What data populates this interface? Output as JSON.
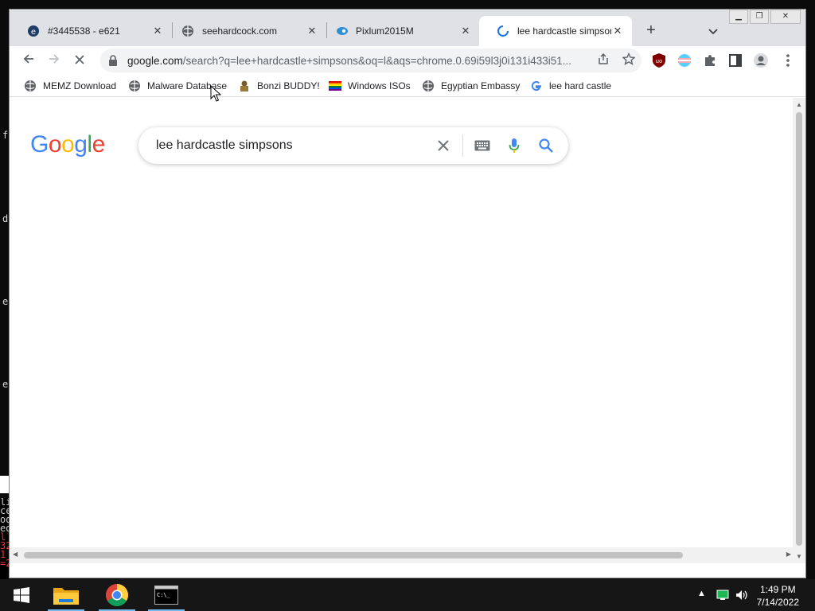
{
  "desktop": {
    "fragments": [
      "f",
      "d",
      "e",
      "e"
    ],
    "terminal_lines": [
      "li",
      "ce",
      "od",
      "ed",
      "l",
      "32",
      "1",
      "=2"
    ]
  },
  "browser": {
    "tabs": [
      {
        "title": "#3445538 - e621",
        "icon": "e621-favicon",
        "active": false
      },
      {
        "title": "seehardcock.com",
        "icon": "globe-icon",
        "active": false
      },
      {
        "title": "Pixlum2015M",
        "icon": "pixlum-favicon",
        "active": false
      },
      {
        "title": "lee hardcastle simpsons",
        "icon": "loading-spinner-icon",
        "active": true
      }
    ],
    "new_tab_label": "+",
    "tab_search_label": "⌄",
    "url_host": "google.com",
    "url_rest": "/search?q=lee+hardcastle+simpsons&oq=l&aqs=chrome.0.69i59l3j0i131i433i51...",
    "bookmarks": [
      {
        "label": "MEMZ Download",
        "icon": "globe-icon"
      },
      {
        "label": "Malware Database",
        "icon": "globe-icon"
      },
      {
        "label": "Bonzi BUDDY!",
        "icon": "bonzi-favicon"
      },
      {
        "label": "Windows ISOs",
        "icon": "rainbow-flag-icon"
      },
      {
        "label": "Egyptian Embassy",
        "icon": "globe-icon"
      },
      {
        "label": "lee hard castle",
        "icon": "google-g-icon"
      }
    ]
  },
  "page": {
    "logo_letters": [
      "G",
      "o",
      "o",
      "g",
      "l",
      "e"
    ],
    "logo_colors": [
      "#4285F4",
      "#EA4335",
      "#FBBC05",
      "#4285F4",
      "#34A853",
      "#EA4335"
    ],
    "search_query": "lee hardcastle simpsons"
  },
  "taskbar": {
    "time": "1:49 PM",
    "date": "7/14/2022",
    "apps": [
      "start-button",
      "file-explorer",
      "chrome",
      "command-prompt"
    ]
  }
}
